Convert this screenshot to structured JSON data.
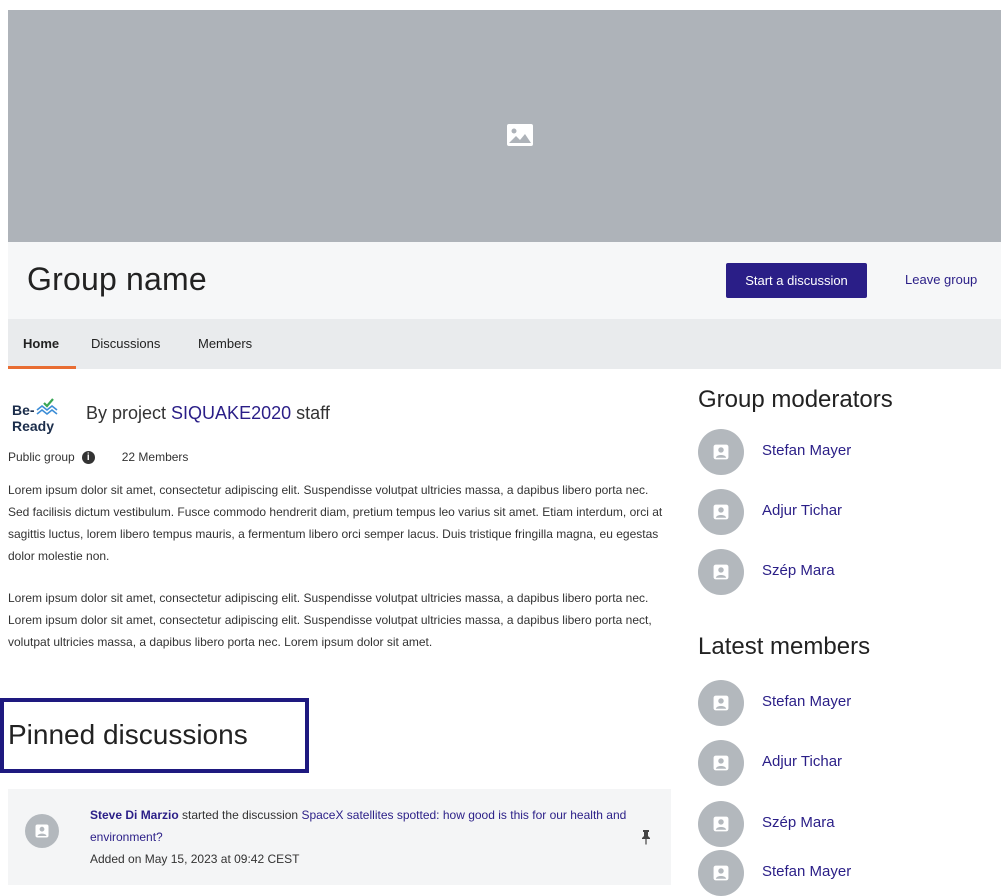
{
  "banner": {
    "icon": "image-placeholder-icon"
  },
  "header": {
    "title": "Group name",
    "start_discussion_label": "Start a discussion",
    "leave_group_label": "Leave group"
  },
  "tabs": [
    {
      "label": "Home",
      "active": true
    },
    {
      "label": "Discussions",
      "active": false
    },
    {
      "label": "Members",
      "active": false
    }
  ],
  "about": {
    "logo_top": "Be-",
    "logo_bottom": "Ready",
    "by_prefix": "By project ",
    "project_name": "SIQUAKE2020",
    "by_suffix": " staff",
    "visibility": "Public group",
    "member_count": "22 Members",
    "paragraphs": [
      "Lorem ipsum dolor sit amet, consectetur adipiscing elit. Suspendisse volutpat ultricies massa, a dapibus libero porta nec. Sed facilisis dictum vestibulum. Fusce commodo hendrerit diam, pretium tempus leo varius sit amet. Etiam interdum, orci at sagittis luctus, lorem libero tempus mauris, a fermentum libero orci semper lacus. Duis tristique fringilla magna, eu egestas dolor molestie non.",
      "Lorem ipsum dolor sit amet, consectetur adipiscing elit. Suspendisse volutpat ultricies massa, a dapibus libero porta nec. Lorem ipsum dolor sit amet, consectetur adipiscing elit. Suspendisse volutpat ultricies massa, a dapibus libero porta nect, volutpat ultricies massa, a dapibus libero porta nec. Lorem ipsum dolor sit amet."
    ]
  },
  "pinned": {
    "title": "Pinned discussions",
    "items": [
      {
        "author": "Steve Di Marzio",
        "action": " started the discussion ",
        "topic": "SpaceX satellites spotted: how good is this for our health and environment?",
        "date": "Added on May 15, 2023 at 09:42 CEST"
      }
    ]
  },
  "moderators": {
    "title": "Group moderators",
    "people": [
      "Stefan Mayer",
      "Adjur Tichar",
      "Szép Mara"
    ]
  },
  "latest_members": {
    "title": "Latest members",
    "people": [
      "Stefan Mayer",
      "Adjur Tichar",
      "Szép Mara",
      "Stefan Mayer"
    ]
  },
  "colors": {
    "primary": "#2a1e87",
    "accent": "#e86d33",
    "banner": "#aeb3b9"
  }
}
